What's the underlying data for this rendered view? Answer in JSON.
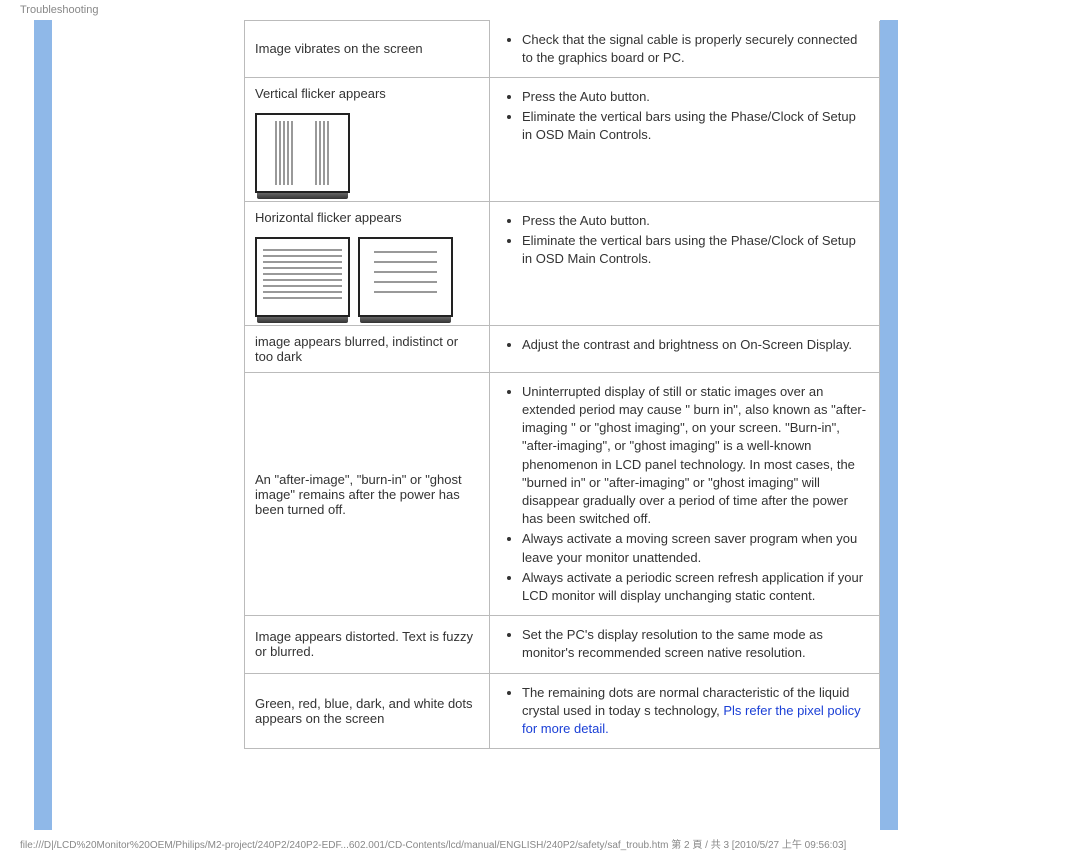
{
  "header": "Troubleshooting",
  "rows": [
    {
      "problem": "Image vibrates on the screen",
      "solutions": [
        "Check that the signal cable is properly securely connected to the graphics board or PC."
      ],
      "merge_up": true
    },
    {
      "problem": "Vertical flicker appears",
      "solutions": [
        "Press the Auto button.",
        "Eliminate the vertical bars using the Phase/Clock of Setup in OSD Main Controls."
      ],
      "illustration": "vertical"
    },
    {
      "problem": "Horizontal flicker appears",
      "solutions": [
        "Press the Auto button.",
        "Eliminate the vertical bars using the Phase/Clock of Setup in OSD Main Controls."
      ],
      "illustration": "horizontal"
    },
    {
      "problem": "image appears blurred, indistinct or too dark",
      "solutions": [
        "Adjust the contrast and brightness on On-Screen Display."
      ]
    },
    {
      "problem": "An \"after-image\", \"burn-in\" or \"ghost image\" remains after the power has been turned off.",
      "solutions": [
        "Uninterrupted display of still or static images over an extended period may cause \" burn in\", also known as \"after-imaging \" or \"ghost imaging\", on your screen. \"Burn-in\", \"after-imaging\", or \"ghost imaging\" is a well-known phenomenon in LCD panel technology. In most cases, the \"burned in\" or \"after-imaging\" or \"ghost imaging\" will disappear gradually over a period of time after the power has been switched off.",
        "Always activate a moving screen saver program when you leave your monitor unattended.",
        "Always activate a periodic screen refresh application if your LCD monitor will display unchanging static content."
      ]
    },
    {
      "problem": "Image appears distorted. Text   is fuzzy or blurred.",
      "solutions": [
        "Set the PC's display resolution to the same mode as monitor's recommended screen native resolution."
      ]
    },
    {
      "problem": "Green, red, blue, dark, and white dots appears on the screen",
      "solutions": [
        "The remaining dots are normal characteristic of the liquid crystal used in today s technology, "
      ],
      "link": "Pls refer the pixel policy for more detail."
    }
  ],
  "footer": "file:///D|/LCD%20Monitor%20OEM/Philips/M2-project/240P2/240P2-EDF...602.001/CD-Contents/lcd/manual/ENGLISH/240P2/safety/saf_troub.htm 第 2 頁 / 共 3  [2010/5/27 上午 09:56:03]"
}
